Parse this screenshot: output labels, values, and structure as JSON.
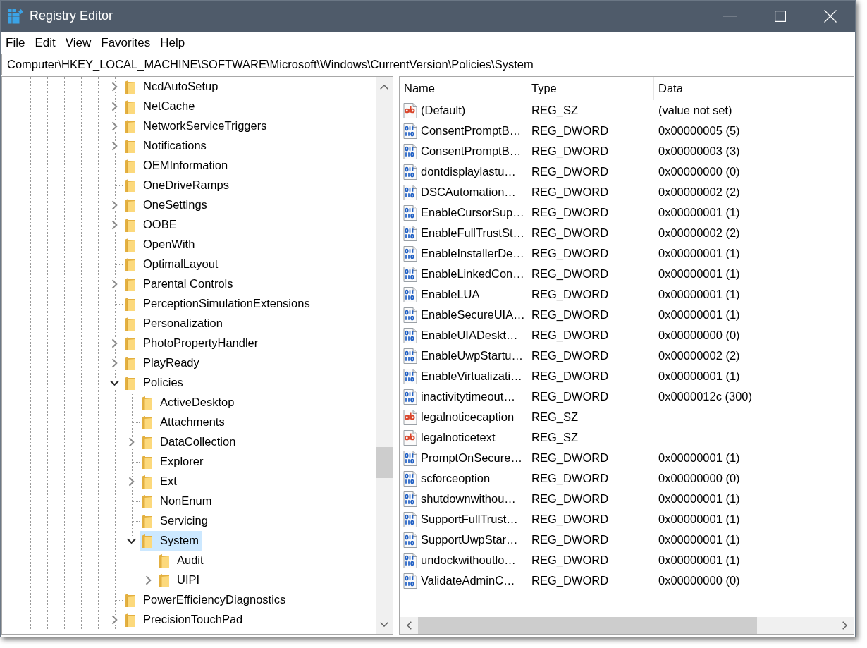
{
  "window": {
    "title": "Registry Editor"
  },
  "menu": [
    "File",
    "Edit",
    "View",
    "Favorites",
    "Help"
  ],
  "address": "Computer\\HKEY_LOCAL_MACHINE\\SOFTWARE\\Microsoft\\Windows\\CurrentVersion\\Policies\\System",
  "tree": {
    "items": [
      {
        "label": "NcdAutoSetup",
        "has_children": true,
        "expanded": false,
        "selected": false
      },
      {
        "label": "NetCache",
        "has_children": true,
        "expanded": false,
        "selected": false
      },
      {
        "label": "NetworkServiceTriggers",
        "has_children": true,
        "expanded": false,
        "selected": false
      },
      {
        "label": "Notifications",
        "has_children": true,
        "expanded": false,
        "selected": false
      },
      {
        "label": "OEMInformation",
        "has_children": false,
        "selected": false
      },
      {
        "label": "OneDriveRamps",
        "has_children": false,
        "selected": false
      },
      {
        "label": "OneSettings",
        "has_children": true,
        "expanded": false,
        "selected": false
      },
      {
        "label": "OOBE",
        "has_children": true,
        "expanded": false,
        "selected": false
      },
      {
        "label": "OpenWith",
        "has_children": false,
        "selected": false
      },
      {
        "label": "OptimalLayout",
        "has_children": false,
        "selected": false
      },
      {
        "label": "Parental Controls",
        "has_children": true,
        "expanded": false,
        "selected": false
      },
      {
        "label": "PerceptionSimulationExtensions",
        "has_children": false,
        "selected": false
      },
      {
        "label": "Personalization",
        "has_children": false,
        "selected": false
      },
      {
        "label": "PhotoPropertyHandler",
        "has_children": true,
        "expanded": false,
        "selected": false
      },
      {
        "label": "PlayReady",
        "has_children": true,
        "expanded": false,
        "selected": false
      },
      {
        "label": "Policies",
        "has_children": true,
        "expanded": true,
        "selected": false,
        "children": [
          {
            "label": "ActiveDesktop",
            "has_children": false,
            "selected": false
          },
          {
            "label": "Attachments",
            "has_children": false,
            "selected": false
          },
          {
            "label": "DataCollection",
            "has_children": true,
            "expanded": false,
            "selected": false
          },
          {
            "label": "Explorer",
            "has_children": false,
            "selected": false
          },
          {
            "label": "Ext",
            "has_children": true,
            "expanded": false,
            "selected": false
          },
          {
            "label": "NonEnum",
            "has_children": false,
            "selected": false
          },
          {
            "label": "Servicing",
            "has_children": false,
            "selected": false
          },
          {
            "label": "System",
            "has_children": true,
            "expanded": true,
            "selected": true,
            "children": [
              {
                "label": "Audit",
                "has_children": false,
                "selected": false
              },
              {
                "label": "UIPI",
                "has_children": true,
                "expanded": false,
                "selected": false
              }
            ]
          }
        ]
      },
      {
        "label": "PowerEfficiencyDiagnostics",
        "has_children": false,
        "selected": false
      },
      {
        "label": "PrecisionTouchPad",
        "has_children": true,
        "expanded": false,
        "selected": false
      }
    ]
  },
  "values": {
    "columns": [
      "Name",
      "Type",
      "Data"
    ],
    "rows": [
      {
        "kind": "string",
        "name": "(Default)",
        "type": "REG_SZ",
        "data": "(value not set)"
      },
      {
        "kind": "binary",
        "name": "ConsentPromptB…",
        "type": "REG_DWORD",
        "data": "0x00000005 (5)"
      },
      {
        "kind": "binary",
        "name": "ConsentPromptB…",
        "type": "REG_DWORD",
        "data": "0x00000003 (3)"
      },
      {
        "kind": "binary",
        "name": "dontdisplaylastu…",
        "type": "REG_DWORD",
        "data": "0x00000000 (0)"
      },
      {
        "kind": "binary",
        "name": "DSCAutomation…",
        "type": "REG_DWORD",
        "data": "0x00000002 (2)"
      },
      {
        "kind": "binary",
        "name": "EnableCursorSup…",
        "type": "REG_DWORD",
        "data": "0x00000001 (1)"
      },
      {
        "kind": "binary",
        "name": "EnableFullTrustSt…",
        "type": "REG_DWORD",
        "data": "0x00000002 (2)"
      },
      {
        "kind": "binary",
        "name": "EnableInstallerDe…",
        "type": "REG_DWORD",
        "data": "0x00000001 (1)"
      },
      {
        "kind": "binary",
        "name": "EnableLinkedCon…",
        "type": "REG_DWORD",
        "data": "0x00000001 (1)"
      },
      {
        "kind": "binary",
        "name": "EnableLUA",
        "type": "REG_DWORD",
        "data": "0x00000001 (1)"
      },
      {
        "kind": "binary",
        "name": "EnableSecureUIA…",
        "type": "REG_DWORD",
        "data": "0x00000001 (1)"
      },
      {
        "kind": "binary",
        "name": "EnableUIADeskt…",
        "type": "REG_DWORD",
        "data": "0x00000000 (0)"
      },
      {
        "kind": "binary",
        "name": "EnableUwpStartu…",
        "type": "REG_DWORD",
        "data": "0x00000002 (2)"
      },
      {
        "kind": "binary",
        "name": "EnableVirtualizati…",
        "type": "REG_DWORD",
        "data": "0x00000001 (1)"
      },
      {
        "kind": "binary",
        "name": "inactivitytimeout…",
        "type": "REG_DWORD",
        "data": "0x0000012c (300)"
      },
      {
        "kind": "string",
        "name": "legalnoticecaption",
        "type": "REG_SZ"
      },
      {
        "kind": "string",
        "name": "legalnoticetext",
        "type": "REG_SZ"
      },
      {
        "kind": "binary",
        "name": "PromptOnSecure…",
        "type": "REG_DWORD",
        "data": "0x00000001 (1)"
      },
      {
        "kind": "binary",
        "name": "scforceoption",
        "type": "REG_DWORD",
        "data": "0x00000000 (0)"
      },
      {
        "kind": "binary",
        "name": "shutdownwithou…",
        "type": "REG_DWORD",
        "data": "0x00000001 (1)"
      },
      {
        "kind": "binary",
        "name": "SupportFullTrust…",
        "type": "REG_DWORD",
        "data": "0x00000001 (1)"
      },
      {
        "kind": "binary",
        "name": "SupportUwpStar…",
        "type": "REG_DWORD",
        "data": "0x00000001 (1)"
      },
      {
        "kind": "binary",
        "name": "undockwithoutlo…",
        "type": "REG_DWORD",
        "data": "0x00000001 (1)"
      },
      {
        "kind": "binary",
        "name": "ValidateAdminC…",
        "type": "REG_DWORD",
        "data": "0x00000000 (0)"
      }
    ]
  }
}
